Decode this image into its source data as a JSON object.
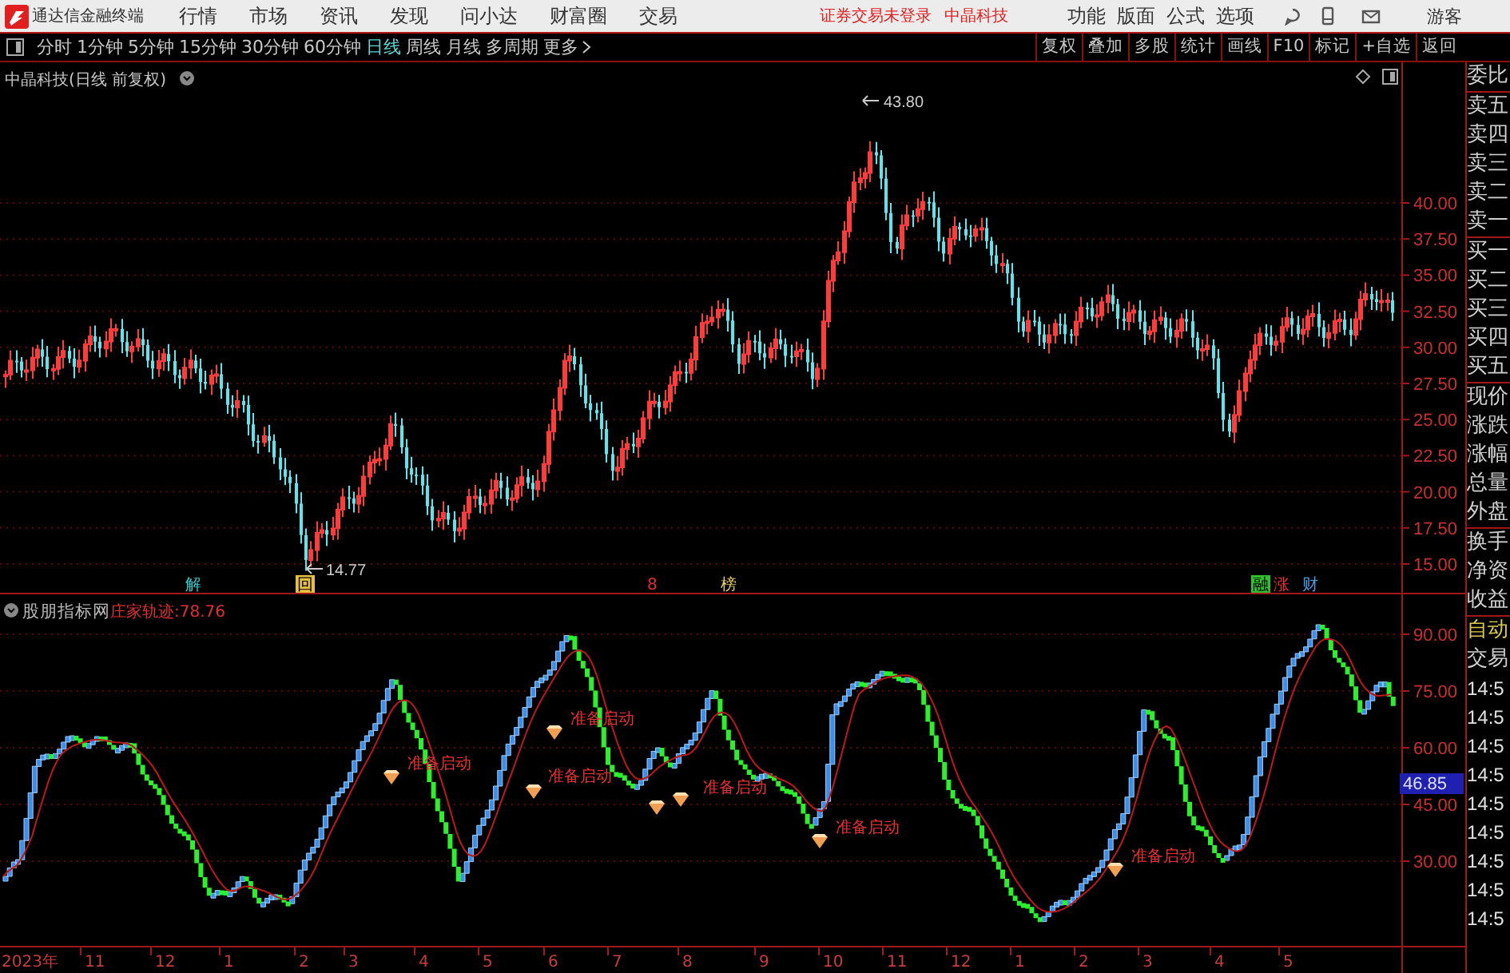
{
  "menubar": {
    "app_title": "通达信金融终端",
    "menus": [
      "行情",
      "市场",
      "资讯",
      "发现",
      "问小达",
      "财富圈",
      "交易"
    ],
    "login_notice": "证券交易未登录",
    "stock_name": "中晶科技",
    "tools": [
      "功能",
      "版面",
      "公式",
      "选项"
    ],
    "user": "游客"
  },
  "periods": [
    {
      "label": "分时",
      "selected": false
    },
    {
      "label": "1分钟",
      "selected": false
    },
    {
      "label": "5分钟",
      "selected": false
    },
    {
      "label": "15分钟",
      "selected": false
    },
    {
      "label": "30分钟",
      "selected": false
    },
    {
      "label": "60分钟",
      "selected": false
    },
    {
      "label": "日线",
      "selected": true
    },
    {
      "label": "周线",
      "selected": false
    },
    {
      "label": "月线",
      "selected": false
    },
    {
      "label": "多周期",
      "selected": false
    },
    {
      "label": "更多",
      "selected": false
    }
  ],
  "chart_tools": [
    "复权",
    "叠加",
    "多股",
    "统计",
    "画线",
    "F10",
    "标记",
    "+自选",
    "返回"
  ],
  "price_chart": {
    "title": "中晶科技(日线 前复权)",
    "high_label": "43.80",
    "low_label": "14.77",
    "axis_ticks": [
      "40.00",
      "37.50",
      "35.00",
      "32.50",
      "30.00",
      "27.50",
      "25.00",
      "22.50",
      "20.00",
      "17.50",
      "15.00"
    ],
    "events": [
      {
        "text": "解",
        "color": "#3cc8c8",
        "boxed": false
      },
      {
        "text": "回",
        "color": "#e8c040",
        "boxed": true
      },
      {
        "text": "8",
        "color": "#e03030",
        "boxed": false
      },
      {
        "text": "榜",
        "color": "#e8c860",
        "boxed": false
      },
      {
        "text": "融",
        "color": "#30c030",
        "boxed": true
      },
      {
        "text": "涨",
        "color": "#e03030",
        "boxed": false
      },
      {
        "text": "财",
        "color": "#40a0e8",
        "boxed": false
      }
    ]
  },
  "indicator": {
    "name": "股朋指标网",
    "readout": "庄家轨迹:78.76",
    "axis_ticks": [
      "90.00",
      "75.00",
      "60.00",
      "45.00",
      "30.00"
    ],
    "current_value": "46.85",
    "signals": [
      "准备启动",
      "准备启动",
      "准备启动",
      "准备启动",
      "准备启动",
      "准备启动"
    ]
  },
  "date_axis": [
    "2023年",
    "11",
    "12",
    "1",
    "2",
    "3",
    "4",
    "5",
    "6",
    "7",
    "8",
    "9",
    "10",
    "11",
    "12",
    "1",
    "2",
    "3",
    "4",
    "5"
  ],
  "side_panel": {
    "groups": [
      [
        "委比"
      ],
      [
        "卖五",
        "卖四",
        "卖三",
        "卖二",
        "卖一"
      ],
      [
        "买一",
        "买二",
        "买三",
        "买四",
        "买五"
      ],
      [
        "现价",
        "涨跌",
        "涨幅",
        "总量",
        "外盘"
      ],
      [
        "换手",
        "净资",
        "收益"
      ]
    ],
    "mode": "自动",
    "trade_label": "交易",
    "times": [
      "14:5",
      "14:5",
      "14:5",
      "14:5",
      "14:5",
      "14:5",
      "14:5",
      "14:5",
      "14:5"
    ]
  }
}
